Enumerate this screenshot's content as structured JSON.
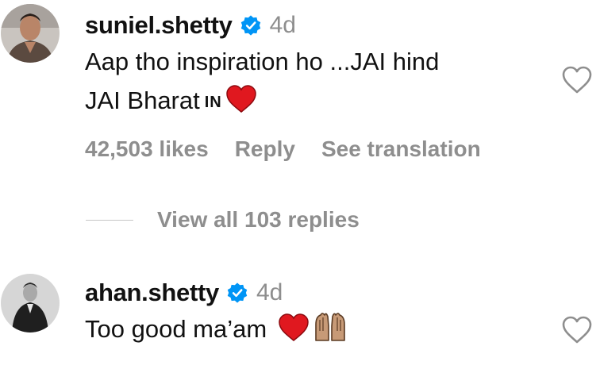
{
  "comments": [
    {
      "username": "suniel.shetty",
      "time": "4d",
      "text_line1": "Aap tho inspiration ho ...JAI hind",
      "text_line2": "JAI Bharat",
      "flag_text": "IN",
      "emojis": [
        "red-heart"
      ],
      "likes": "42,503 likes",
      "reply_label": "Reply",
      "translate_label": "See translation",
      "view_replies": "View all 103 replies"
    },
    {
      "username": "ahan.shetty",
      "time": "4d",
      "text_line1": "Too good ma’am",
      "emojis": [
        "red-heart",
        "raising-hands"
      ]
    }
  ],
  "colors": {
    "verified_blue": "#0095f6",
    "secondary_text": "#8e8e8e",
    "heart_red": "#e0181f"
  }
}
